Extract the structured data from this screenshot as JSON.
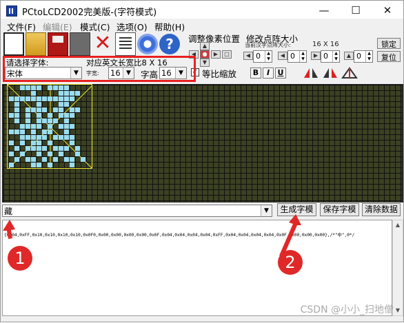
{
  "window": {
    "title": "PCtoLCD2002完美版-(字符模式)",
    "minimize_glyph": "—",
    "maximize_glyph": "☐",
    "close_glyph": "✕"
  },
  "menu": [
    {
      "label": "文件(F)",
      "enabled": true
    },
    {
      "label": "编辑(E)",
      "enabled": false
    },
    {
      "label": "模式(C)",
      "enabled": true
    },
    {
      "label": "选项(O)",
      "enabled": true
    },
    {
      "label": "帮助(H)",
      "enabled": true
    }
  ],
  "toolbar": {
    "icons": [
      "new-document-icon",
      "open-folder-icon",
      "save-icon",
      "save-as-icon",
      "delete-icon",
      "notes-icon",
      "settings-icon",
      "help-icon"
    ],
    "delete_glyph": "✕",
    "help_glyph": "?",
    "adjust_pixel_label": "调整像素位置",
    "dot_size_label": "修改点阵大小",
    "current_dot_size_label": "当前汉字点阵大小:",
    "current_dot_size_value": "16 X 16",
    "lock_button": "锁定",
    "restore_button": "复位",
    "spinners": [
      {
        "prefix": "◀",
        "value": "0"
      },
      {
        "prefix": "◀",
        "value": "0"
      },
      {
        "prefix": "▶",
        "value": "0"
      },
      {
        "prefix": "▲",
        "value": "0"
      },
      {
        "prefix": "▼",
        "value": "0"
      }
    ],
    "select_font_label": "请选择字体:",
    "font_value": "宋体",
    "char_width_label": "字宽:",
    "char_width_value": "16",
    "char_height_label": "字高",
    "char_height_value": "16",
    "ratio_text": "对应英文长宽比8 X 16",
    "proportional_label": "等比缩放",
    "proportional_checked": "✓",
    "bold_label": "B",
    "italic_label": "I",
    "underline_label": "U"
  },
  "canvas": {
    "lit_pixels": [
      [
        3,
        0
      ],
      [
        4,
        0
      ],
      [
        5,
        0
      ],
      [
        6,
        0
      ],
      [
        8,
        0
      ],
      [
        9,
        0
      ],
      [
        10,
        0
      ],
      [
        11,
        0
      ],
      [
        5,
        1
      ],
      [
        10,
        1
      ],
      [
        11,
        1
      ],
      [
        12,
        1
      ],
      [
        13,
        1
      ],
      [
        1,
        2
      ],
      [
        2,
        2
      ],
      [
        3,
        2
      ],
      [
        4,
        2
      ],
      [
        5,
        2
      ],
      [
        6,
        2
      ],
      [
        7,
        2
      ],
      [
        8,
        2
      ],
      [
        9,
        2
      ],
      [
        10,
        2
      ],
      [
        11,
        2
      ],
      [
        12,
        2
      ],
      [
        2,
        3
      ],
      [
        6,
        3
      ],
      [
        10,
        3
      ],
      [
        11,
        3
      ],
      [
        2,
        4
      ],
      [
        4,
        4
      ],
      [
        5,
        4
      ],
      [
        6,
        4
      ],
      [
        7,
        4
      ],
      [
        9,
        4
      ],
      [
        10,
        4
      ],
      [
        12,
        4
      ],
      [
        13,
        4
      ],
      [
        1,
        5
      ],
      [
        2,
        5
      ],
      [
        4,
        5
      ],
      [
        6,
        5
      ],
      [
        8,
        5
      ],
      [
        10,
        5
      ],
      [
        11,
        5
      ],
      [
        12,
        5
      ],
      [
        2,
        6
      ],
      [
        4,
        6
      ],
      [
        6,
        6
      ],
      [
        7,
        6
      ],
      [
        8,
        6
      ],
      [
        9,
        6
      ],
      [
        11,
        6
      ],
      [
        3,
        7
      ],
      [
        4,
        7
      ],
      [
        5,
        7
      ],
      [
        6,
        7
      ],
      [
        8,
        7
      ],
      [
        10,
        7
      ],
      [
        11,
        7
      ],
      [
        12,
        7
      ],
      [
        1,
        8
      ],
      [
        2,
        8
      ],
      [
        3,
        8
      ],
      [
        5,
        8
      ],
      [
        7,
        8
      ],
      [
        8,
        8
      ],
      [
        11,
        8
      ],
      [
        3,
        9
      ],
      [
        4,
        9
      ],
      [
        5,
        9
      ],
      [
        6,
        9
      ],
      [
        7,
        9
      ],
      [
        9,
        9
      ],
      [
        10,
        9
      ],
      [
        11,
        9
      ],
      [
        12,
        9
      ],
      [
        1,
        10
      ],
      [
        3,
        10
      ],
      [
        5,
        10
      ],
      [
        6,
        10
      ],
      [
        8,
        10
      ],
      [
        12,
        10
      ],
      [
        2,
        11
      ],
      [
        4,
        11
      ],
      [
        5,
        11
      ],
      [
        6,
        11
      ],
      [
        7,
        11
      ],
      [
        9,
        11
      ],
      [
        10,
        11
      ],
      [
        11,
        11
      ],
      [
        13,
        11
      ],
      [
        1,
        12
      ],
      [
        3,
        12
      ],
      [
        6,
        12
      ],
      [
        8,
        12
      ],
      [
        10,
        12
      ],
      [
        13,
        12
      ],
      [
        2,
        13
      ],
      [
        4,
        13
      ],
      [
        5,
        13
      ],
      [
        7,
        13
      ],
      [
        9,
        13
      ],
      [
        11,
        13
      ],
      [
        12,
        13
      ],
      [
        14,
        13
      ],
      [
        1,
        14
      ],
      [
        5,
        14
      ],
      [
        6,
        14
      ],
      [
        8,
        14
      ],
      [
        12,
        14
      ],
      [
        5,
        15
      ],
      [
        6,
        15
      ],
      [
        7,
        15
      ],
      [
        8,
        15
      ],
      [
        9,
        15
      ],
      [
        14,
        15
      ]
    ]
  },
  "input": {
    "char_value": "藏",
    "generate_button": "生成字模",
    "save_button": "保存字模",
    "clear_button": "清除数据"
  },
  "output": {
    "text": "{0x04,0xFF,0x10,0x10,0x10,0x10,0x0F0,0x00,0x00,0x00,0x00,0x0F,0x04,0x04,0x04,0x04,0xFF,0x04,0x04,0x04,0x04,0x0F,0x00,0x00,0x00},/*\"中\",0*/"
  },
  "annotations": {
    "badge_1": "1",
    "badge_2": "2"
  },
  "watermark": "CSDN @小小_扫地僧",
  "colors": {
    "highlight": "#e82020",
    "pixel_on": "#9adcf0",
    "grid_bg": "#3b4122",
    "yellow": "#f2e832"
  }
}
